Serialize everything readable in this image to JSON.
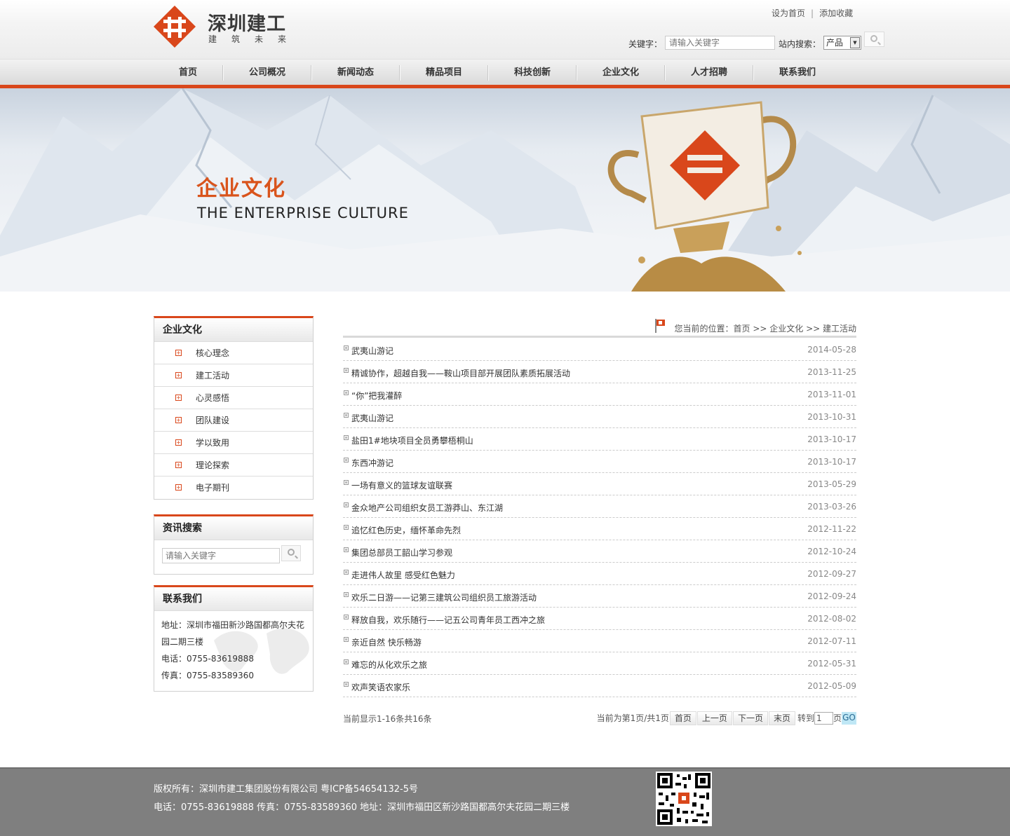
{
  "header": {
    "logo_title": "深圳建工",
    "logo_subtitle": "建筑未来",
    "links": [
      "设为首页",
      "添加收藏"
    ],
    "link_separator": "|",
    "keyword_label": "关键字：",
    "keyword_placeholder": "请输入关键字",
    "site_search_label": "站内搜索：",
    "site_search_selected": "产品",
    "brand_color": "#d9471b"
  },
  "nav": {
    "items": [
      "首页",
      "公司概况",
      "新闻动态",
      "精品项目",
      "科技创新",
      "企业文化",
      "人才招聘",
      "联系我们"
    ]
  },
  "banner": {
    "title": "企业文化",
    "subtitle": "THE ENTERPRISE CULTURE"
  },
  "sidebar": {
    "category_title": "企业文化",
    "categories": [
      "核心理念",
      "建工活动",
      "心灵感悟",
      "团队建设",
      "学以致用",
      "理论探索",
      "电子期刊"
    ],
    "search_title": "资讯搜索",
    "search_placeholder": "请输入关键字",
    "contact_title": "联系我们",
    "contact_address": "地址：深圳市福田新沙路国都高尔夫花园二期三楼",
    "contact_phone": "电话：0755-83619888",
    "contact_fax": "传真：0755-83589360"
  },
  "breadcrumb": {
    "text": "您当前的位置：首页 >> 企业文化 >> 建工活动"
  },
  "news": [
    {
      "title": "武夷山游记",
      "date": "2014-05-28"
    },
    {
      "title": "精诚协作，超越自我——鞍山项目部开展团队素质拓展活动",
      "date": "2013-11-25"
    },
    {
      "title": "“你”把我灌醉",
      "date": "2013-11-01"
    },
    {
      "title": "武夷山游记",
      "date": "2013-10-31"
    },
    {
      "title": "盐田1#地块项目全员勇攀梧桐山",
      "date": "2013-10-17"
    },
    {
      "title": "东西冲游记",
      "date": "2013-10-17"
    },
    {
      "title": "一场有意义的篮球友谊联赛",
      "date": "2013-05-29"
    },
    {
      "title": "金众地产公司组织女员工游莽山、东江湖",
      "date": "2013-03-26"
    },
    {
      "title": "追忆红色历史，缅怀革命先烈",
      "date": "2012-11-22"
    },
    {
      "title": "集团总部员工韶山学习参观",
      "date": "2012-10-24"
    },
    {
      "title": "走进伟人故里 感受红色魅力",
      "date": "2012-09-27"
    },
    {
      "title": "欢乐二日游——记第三建筑公司组织员工旅游活动",
      "date": "2012-09-24"
    },
    {
      "title": "释放自我，欢乐随行——记五公司青年员工西冲之旅",
      "date": "2012-08-02"
    },
    {
      "title": "亲近自然 快乐畅游",
      "date": "2012-07-11"
    },
    {
      "title": "难忘的从化欢乐之旅",
      "date": "2012-05-31"
    },
    {
      "title": "欢声笑语农家乐",
      "date": "2012-05-09"
    }
  ],
  "pager": {
    "summary": "当前显示1-16条共16条",
    "page_info": "当前为第1页/共1页",
    "first": "首页",
    "prev": "上一页",
    "next": "下一页",
    "last": "末页",
    "goto_label": "转到",
    "goto_value": "1",
    "page_suffix": "页",
    "go": "GO"
  },
  "footer": {
    "copyright": "版权所有：深圳市建工集团股份有限公司 粤ICP备54654132-5号",
    "contact": "电话：0755-83619888 传真：0755-83589360 地址：深圳市福田区新沙路国都高尔夫花园二期三楼"
  }
}
